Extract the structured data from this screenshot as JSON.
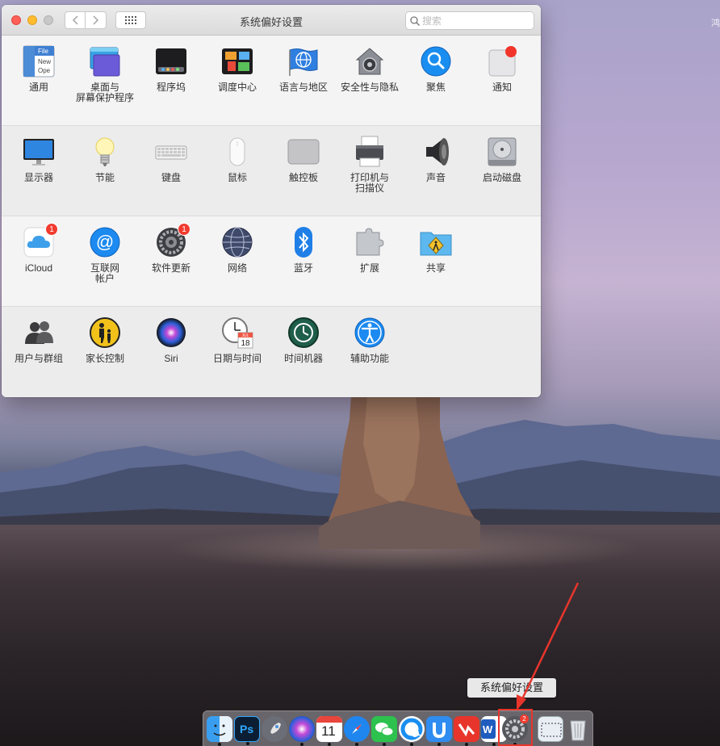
{
  "window": {
    "title": "系统偏好设置",
    "search_placeholder": "搜索"
  },
  "sections": [
    {
      "panes": [
        {
          "label": "通用"
        },
        {
          "label": "桌面与\n屏幕保护程序"
        },
        {
          "label": "程序坞"
        },
        {
          "label": "调度中心"
        },
        {
          "label": "语言与地区"
        },
        {
          "label": "安全性与隐私"
        },
        {
          "label": "聚焦"
        },
        {
          "label": "通知"
        }
      ]
    },
    {
      "panes": [
        {
          "label": "显示器"
        },
        {
          "label": "节能"
        },
        {
          "label": "键盘"
        },
        {
          "label": "鼠标"
        },
        {
          "label": "触控板"
        },
        {
          "label": "打印机与\n扫描仪"
        },
        {
          "label": "声音"
        },
        {
          "label": "启动磁盘"
        }
      ]
    },
    {
      "panes": [
        {
          "label": "iCloud",
          "badge": "1"
        },
        {
          "label": "互联网\n帐户"
        },
        {
          "label": "软件更新",
          "badge": "1"
        },
        {
          "label": "网络"
        },
        {
          "label": "蓝牙"
        },
        {
          "label": "扩展"
        },
        {
          "label": "共享"
        }
      ]
    },
    {
      "panes": [
        {
          "label": "用户与群组"
        },
        {
          "label": "家长控制"
        },
        {
          "label": "Siri"
        },
        {
          "label": "日期与时间"
        },
        {
          "label": "时间机器"
        },
        {
          "label": "辅助功能"
        }
      ]
    }
  ],
  "icons": {
    "general_file": "File",
    "general_new": "New",
    "general_ope": "Ope",
    "calendar_month": "JUL",
    "calendar_day": "18",
    "dock_calendar_day": "11",
    "dock_ps": "Ps",
    "dock_word": "W",
    "dock_badge": "2"
  },
  "desktop": {
    "corner_text": "鸿",
    "tooltip": "系统偏好设置"
  },
  "colors": {
    "accent_red": "#e8352c",
    "badge_red": "#f23b2f"
  }
}
